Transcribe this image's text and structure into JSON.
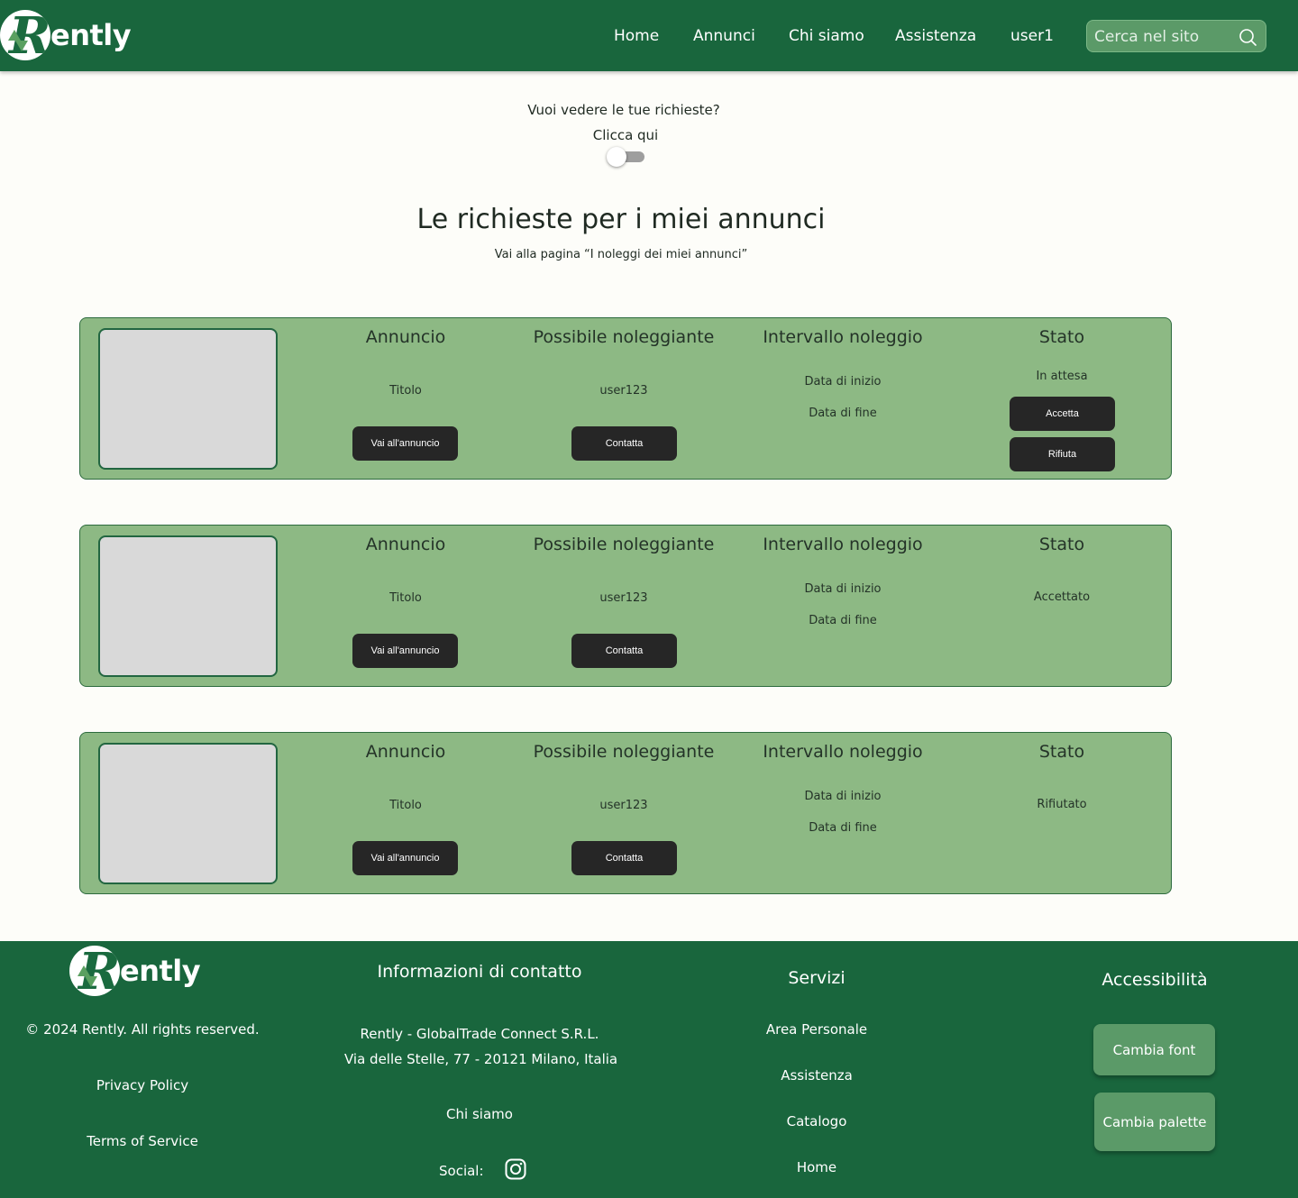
{
  "brand": {
    "logo_text": "ently"
  },
  "nav": {
    "items": [
      {
        "label": "Home"
      },
      {
        "label": "Annunci"
      },
      {
        "label": "Chi siamo"
      },
      {
        "label": "Assistenza"
      },
      {
        "label": "user1"
      }
    ]
  },
  "search": {
    "placeholder": "Cerca nel sito",
    "icon": "search-icon"
  },
  "intro": {
    "question": "Vuoi vedere le tue richieste?",
    "click_here": "Clicca qui",
    "toggle_on": false
  },
  "page": {
    "title": "Le richieste per i miei annunci",
    "link": "Vai alla pagina “I noleggi dei miei annunci”"
  },
  "columns": {
    "annuncio": "Annuncio",
    "noleggiante": "Possibile noleggiante",
    "intervallo": "Intervallo noleggio",
    "stato": "Stato"
  },
  "requests": [
    {
      "titolo": "Titolo",
      "user": "user123",
      "start": "Data di inizio",
      "end": "Data di fine",
      "status": "In attesa",
      "btn_annuncio": "Vai all'annuncio",
      "btn_contatta": "Contatta",
      "btn_accetta": "Accetta",
      "btn_rifiuta": "Rifiuta"
    },
    {
      "titolo": "Titolo",
      "user": "user123",
      "start": "Data di inizio",
      "end": "Data di fine",
      "status": "Accettato",
      "btn_annuncio": "Vai all'annuncio",
      "btn_contatta": "Contatta"
    },
    {
      "titolo": "Titolo",
      "user": "user123",
      "start": "Data di inizio",
      "end": "Data di fine",
      "status": "Rifiutato",
      "btn_annuncio": "Vai all'annuncio",
      "btn_contatta": "Contatta"
    }
  ],
  "footer": {
    "logo_text": "ently",
    "copyright": "© 2024 Rently. All rights reserved.",
    "privacy": "Privacy Policy",
    "terms": "Terms of Service",
    "contact_heading": "Informazioni di contatto",
    "company": "Rently - GlobalTrade Connect S.R.L.",
    "address": "Via delle Stelle, 77 - 20121 Milano, Italia",
    "about": "Chi siamo",
    "social_label": "Social:",
    "social_icon": "instagram-icon",
    "services_heading": "Servizi",
    "services": [
      "Area Personale",
      "Assistenza",
      "Catalogo",
      "Home"
    ],
    "accessibility_heading": "Accessibilità",
    "change_font": "Cambia font",
    "change_palette": "Cambia palette"
  },
  "colors": {
    "header_bg": "#19663d",
    "card_bg": "#8db984",
    "button_dark": "#262626",
    "accent_button": "#5b9a68",
    "page_bg": "#fdfdf9"
  }
}
